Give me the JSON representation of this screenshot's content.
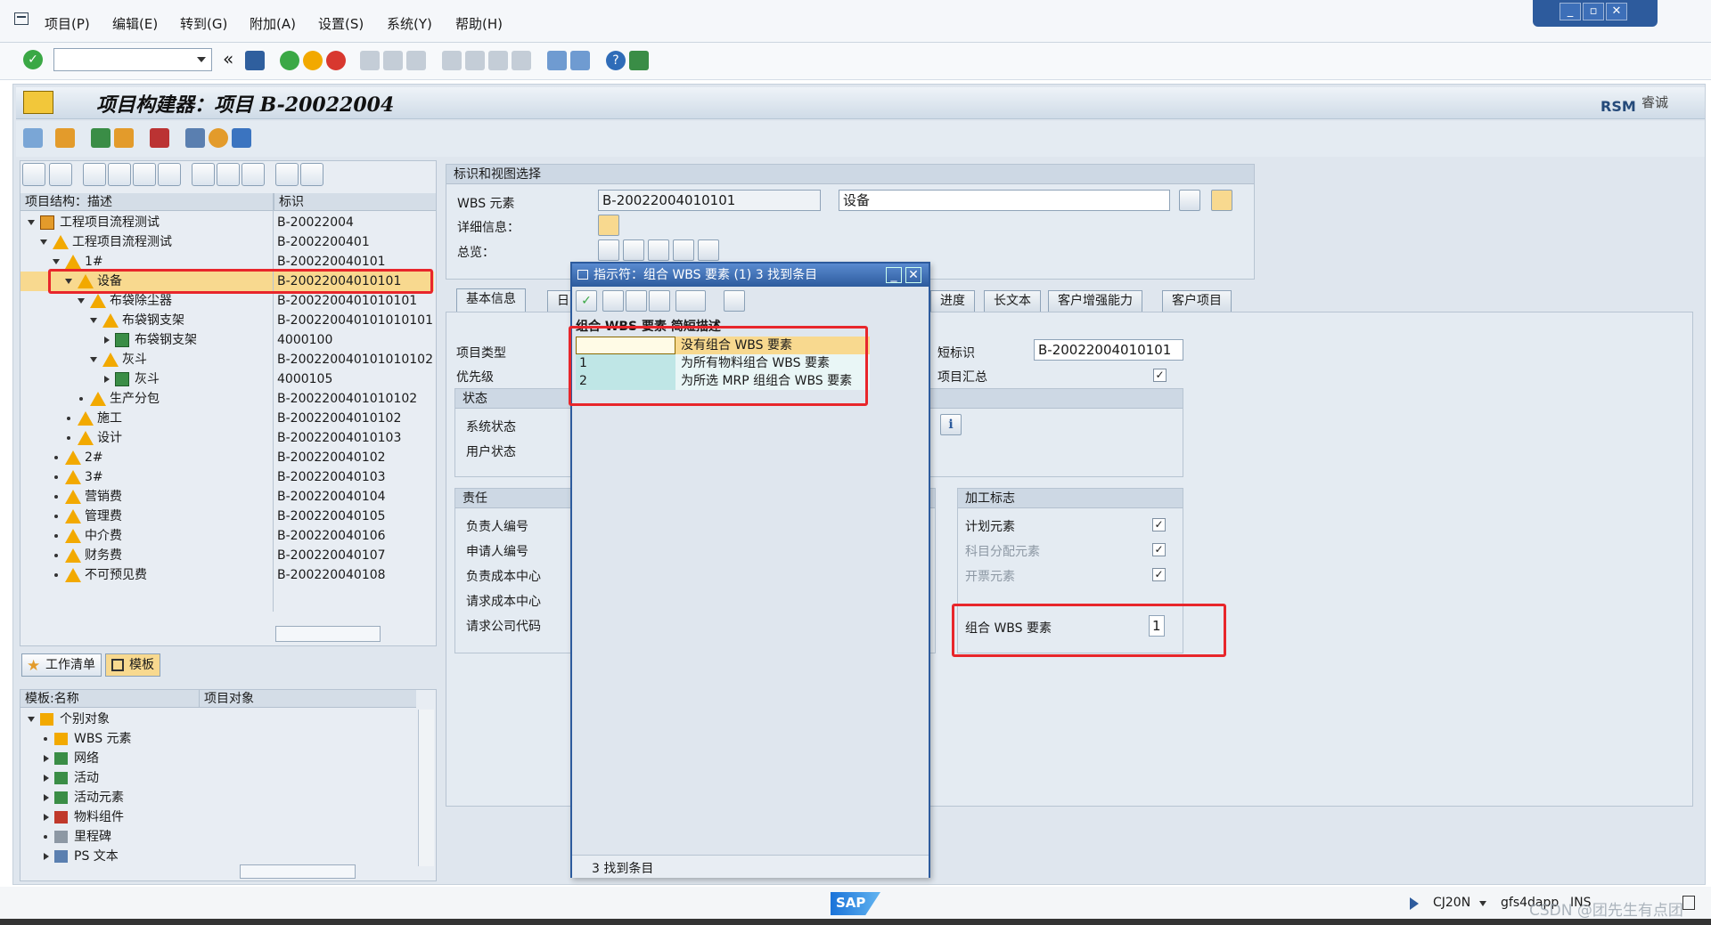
{
  "menu": {
    "items": [
      "项目(P)",
      "编辑(E)",
      "转到(G)",
      "附加(A)",
      "设置(S)",
      "系统(Y)",
      "帮助(H)"
    ]
  },
  "window": {
    "title": "项目构建器：项目 B-20022004",
    "brand": "RSM",
    "brand_sub": "睿诚"
  },
  "toolbar": {
    "command_value": "",
    "back_glyph": "«"
  },
  "tree": {
    "col_desc": "项目结构：描述",
    "col_id": "标识",
    "rows": [
      {
        "label": "工程项目流程测试",
        "id": "B-20022004",
        "level": 0
      },
      {
        "label": "工程项目流程测试",
        "id": "B-2002200401",
        "level": 1
      },
      {
        "label": "1#",
        "id": "B-200220040101",
        "level": 2
      },
      {
        "label": "设备",
        "id": "B-20022004010101",
        "level": 3
      },
      {
        "label": "布袋除尘器",
        "id": "B-2002200401010101",
        "level": 4
      },
      {
        "label": "布袋钢支架",
        "id": "B-200220040101010101",
        "level": 5
      },
      {
        "label": "布袋钢支架",
        "id": "4000100",
        "level": 6
      },
      {
        "label": "灰斗",
        "id": "B-200220040101010102",
        "level": 5
      },
      {
        "label": "灰斗",
        "id": "4000105",
        "level": 6
      },
      {
        "label": "生产分包",
        "id": "B-2002200401010102",
        "level": 4
      },
      {
        "label": "施工",
        "id": "B-20022004010102",
        "level": 3
      },
      {
        "label": "设计",
        "id": "B-20022004010103",
        "level": 3
      },
      {
        "label": "2#",
        "id": "B-200220040102",
        "level": 2
      },
      {
        "label": "3#",
        "id": "B-200220040103",
        "level": 2
      },
      {
        "label": "营销费",
        "id": "B-200220040104",
        "level": 2
      },
      {
        "label": "管理费",
        "id": "B-200220040105",
        "level": 2
      },
      {
        "label": "中介费",
        "id": "B-200220040106",
        "level": 2
      },
      {
        "label": "财务费",
        "id": "B-200220040107",
        "level": 2
      },
      {
        "label": "不可预见费",
        "id": "B-200220040108",
        "level": 2
      }
    ]
  },
  "lower": {
    "worklist_tab": "工作清单",
    "template_tab": "模板",
    "col_name": "模板:名称",
    "col_obj": "项目对象",
    "items": [
      "个别对象",
      "WBS 元素",
      "网络",
      "活动",
      "活动元素",
      "物料组件",
      "里程碑",
      "PS 文本"
    ]
  },
  "ident": {
    "header": "标识和视图选择",
    "wbs_label": "WBS 元素",
    "wbs_value": "B-20022004010101",
    "wbs_desc": "设备",
    "detail_label": "详细信息：",
    "overview_label": "总览："
  },
  "tabs": [
    "基本信息",
    "日",
    "进度",
    "长文本",
    "客户增强能力",
    "客户项目"
  ],
  "basic": {
    "proj_type": "项目类型",
    "priority": "优先级",
    "status_header": "状态",
    "sys_status": "系统状态",
    "user_status": "用户状态",
    "short_id_label": "短标识",
    "short_id_value": "B-20022004010101",
    "proj_summary": "项目汇总",
    "resp_header": "责任",
    "resp_fields": [
      "负责人编号",
      "申请人编号",
      "负责成本中心",
      "请求成本中心",
      "请求公司代码"
    ],
    "proc_header": "加工标志",
    "plan_elem": "计划元素",
    "acct_elem": "科目分配元素",
    "bill_elem": "开票元素",
    "group_wbs_label": "组合 WBS 要素",
    "group_wbs_value": "1",
    "check": "✓"
  },
  "popup": {
    "title": "指示符：组合 WBS 要素 (1)   3 找到条目",
    "col_header": "组合 WBS 要素 简短描述",
    "rows": [
      {
        "code": "",
        "desc": "没有组合 WBS 要素"
      },
      {
        "code": "1",
        "desc": "为所有物料组合 WBS 要素"
      },
      {
        "code": "2",
        "desc": "为所选 MRP 组组合 WBS 要素"
      }
    ],
    "footer": "3 找到条目"
  },
  "status": {
    "tcode": "CJ20N",
    "server": "gfs4dapp",
    "mode": "INS",
    "sap_logo": "SAP",
    "watermark": "CSDN @团先生有点团"
  },
  "colors": {
    "accent": "#2d5b9d",
    "highlight": "#f8d98f",
    "red_box": "#e8262b",
    "warn": "#f2a900"
  }
}
